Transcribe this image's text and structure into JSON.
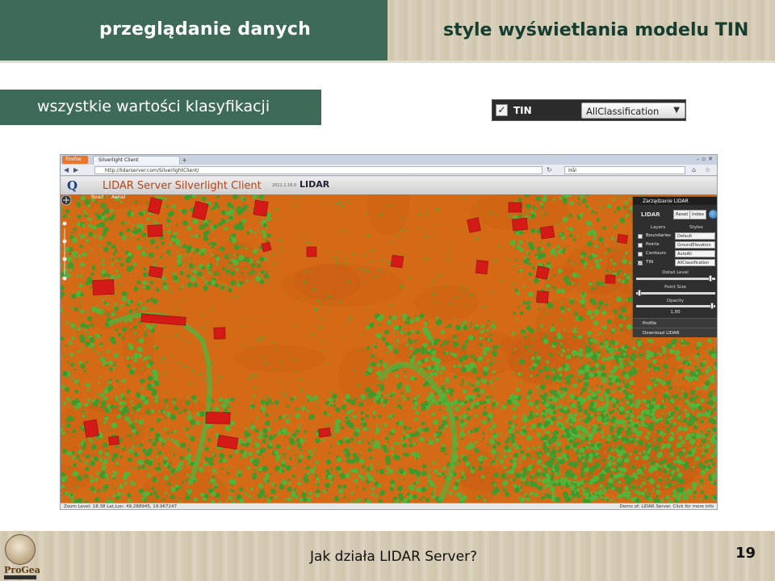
{
  "header": {
    "left_title": "przeglądanie danych",
    "right_title": "style wyświetlania modelu TIN"
  },
  "subtitle": "wszystkie wartości klasyfikacji",
  "tin_control": {
    "checked": true,
    "label": "TIN",
    "selected": "AllClassification"
  },
  "browser": {
    "menu_button": "Firefox",
    "tab_title": "Silverlight Client",
    "url": "http://lidarserver.com/SilverlightClient/",
    "search": "Hål",
    "app_title": "LIDAR Server Silverlight Client",
    "version": "2011.1.16.0",
    "lidar_logo": "LIDAR",
    "map_tabs": [
      "Road",
      "Aerial"
    ],
    "status_left": "Zoom Level: 18.38   Lat,Lon: 49.288945, 19.967247",
    "status_right": "Demo of: LIDAR Server. Click for more info",
    "panel": {
      "title": "Zarządzanie LIDAR",
      "logo": "LIDAR",
      "buttons": [
        "Reset",
        "Index"
      ],
      "col_layers": "Layers",
      "col_styles": "Styles",
      "layers": [
        {
          "name": "Boundaries",
          "checked": false,
          "style": "Default"
        },
        {
          "name": "Points",
          "checked": false,
          "style": "GroundElevation"
        },
        {
          "name": "Contours",
          "checked": false,
          "style": "AutoAll"
        },
        {
          "name": "TIN",
          "checked": true,
          "style": "AllClassification"
        }
      ],
      "detail_label": "Detail Level",
      "point_size_label": "Point Size",
      "opacity_label": "Opacity",
      "opacity_value": "1,00",
      "detail_level": 0.98,
      "point_size": 0.02,
      "opacity": 1.0,
      "profile": "Profile",
      "download": "Download LIDAR"
    }
  },
  "footer": {
    "text": "Jak działa LIDAR Server?",
    "page_number": "19",
    "logo_text": "ProGea"
  },
  "colors": {
    "header_green": "#3e6b57",
    "terrain_orange": "#d46a16",
    "vegetation_green": "#53b43a",
    "building_red": "#d41a16"
  }
}
